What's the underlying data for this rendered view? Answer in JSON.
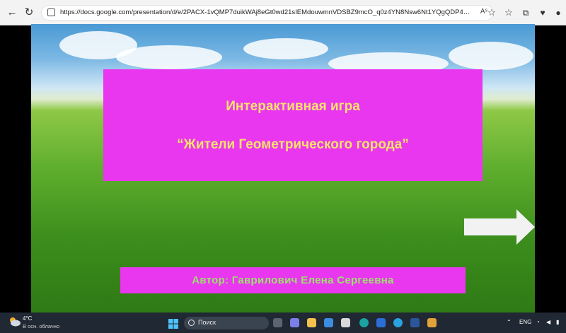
{
  "browser": {
    "url": "https://docs.google.com/presentation/d/e/2PACX-1vQMP7duikWAj8eGt0wd21sIEMdouwmnVDSBZ9mcO_q0z4YN8Nsw6Nt1YQgQDP4PDxLRNKVMtutMFfWl/pub?s...",
    "reader_icon": "Aˢ"
  },
  "slide": {
    "title_line1": "Интерактивная игра",
    "title_line2": "“Жители Геометрического города”",
    "author": "Автор: Гаврилович Елена Сергеевна",
    "colors": {
      "box": "#e936ef",
      "title_text": "#f7e36a",
      "author_text": "#9be26b"
    }
  },
  "taskbar": {
    "temperature": "4°C",
    "weather": "В осн. облачно",
    "search_label": "Поиск",
    "lang": "ENG"
  }
}
